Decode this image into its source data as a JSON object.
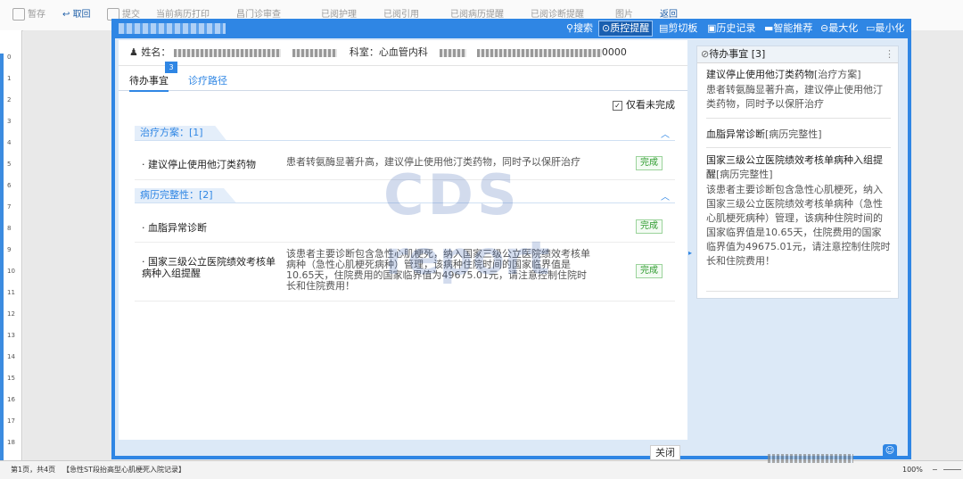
{
  "toolbar": {
    "save": "暂存",
    "back": "取回",
    "submit": "提交",
    "print": "当前病历打印",
    "review": "昌门诊审查",
    "t1": "已阅护理",
    "t2": "已阅引用",
    "t3": "已阅病历提醒",
    "t4": "已阅诊断提醒",
    "t5": "图片",
    "t6": "返回"
  },
  "dialog": {
    "actions": {
      "search": "搜索",
      "qc_reminder": "质控提醒",
      "clipboard": "剪切板",
      "history": "历史记录",
      "smart": "智能推荐",
      "maximize": "最大化",
      "minimize": "最小化"
    },
    "patient": {
      "name_label": "姓名：",
      "dept_label": "科室：",
      "dept_value": "心血管内科",
      "id_suffix": "0000"
    },
    "tabs": {
      "todo": "待办事宜",
      "todo_badge": "3",
      "path": "诊疗路径"
    },
    "only_unfinished": "仅看未完成",
    "sections": [
      {
        "label": "治疗方案：[1]",
        "items": [
          {
            "title": "建议停止使用他汀类药物",
            "desc": "患者转氨酶显著升高，建议停止使用他汀类药物，同时予以保肝治疗",
            "status": "完成"
          }
        ]
      },
      {
        "label": "病历完整性：[2]",
        "items": [
          {
            "title": "血脂异常诊断",
            "desc": "",
            "status": "完成"
          },
          {
            "title": "国家三级公立医院绩效考核单病种入组提醒",
            "desc": "该患者主要诊断包含急性心肌梗死，纳入国家三级公立医院绩效考核单病种（急性心肌梗死病种）管理，该病种住院时间的国家临界值是10.65天，住院费用的国家临界值为49675.01元，请注意控制住院时长和住院费用！",
            "status": "完成"
          }
        ]
      }
    ],
    "close": "关闭"
  },
  "side_panel": {
    "title": "待办事宜 [3]",
    "items": [
      {
        "title": "建议停止使用他汀类药物",
        "tag": "[治疗方案]",
        "desc": "患者转氨酶显著升高，建议停止使用他汀类药物，同时予以保肝治疗"
      },
      {
        "title": "血脂异常诊断",
        "tag": "[病历完整性]",
        "desc": ""
      },
      {
        "title": "国家三级公立医院绩效考核单病种入组提醒",
        "tag": "[病历完整性]",
        "desc": "该患者主要诊断包含急性心肌梗死，纳入国家三级公立医院绩效考核单病种（急性心肌梗死病种）管理，该病种住院时间的国家临界值是10.65天，住院费用的国家临界值为49675.01元，请注意控制住院时长和住院费用！"
      }
    ]
  },
  "status_bar": {
    "page": "第1页，共4页",
    "doc": "【急性ST段抬高型心肌梗死入院记录】",
    "zoom": "100%"
  },
  "watermark": {
    "line1": "CDS",
    "line2": "report"
  },
  "ruler": [
    "0",
    "1",
    "2",
    "3",
    "4",
    "5",
    "6",
    "7",
    "8",
    "9",
    "10",
    "11",
    "12",
    "13",
    "14",
    "15",
    "16",
    "17",
    "18"
  ],
  "colors": {
    "accent": "#2f86e4",
    "done": "#2e9b2e"
  }
}
